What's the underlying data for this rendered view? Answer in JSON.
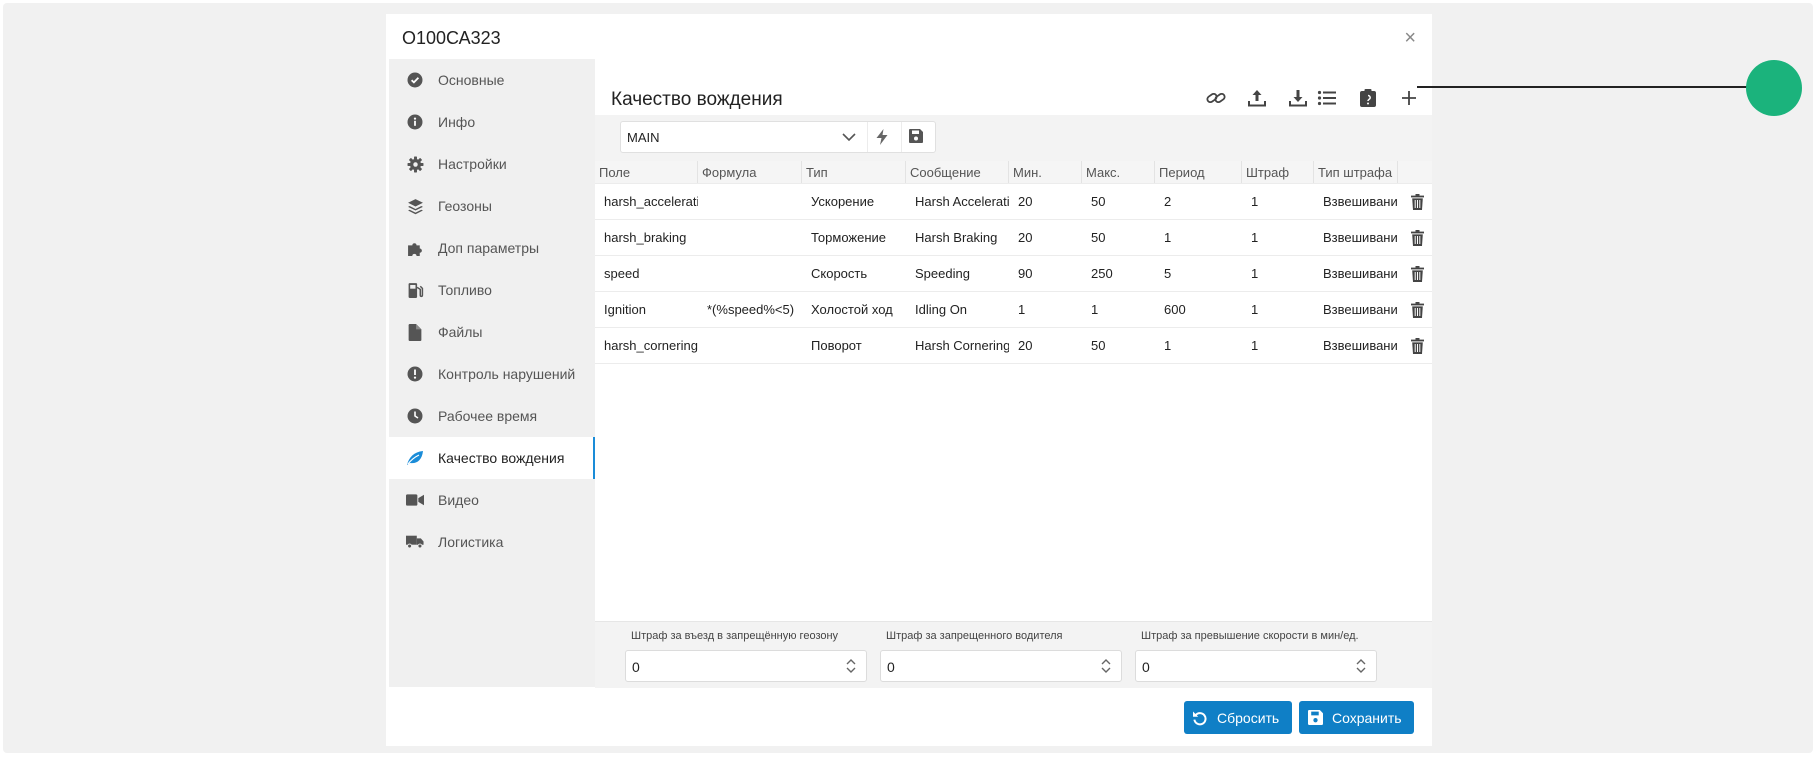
{
  "dialog": {
    "title": "О100СА323",
    "close_glyph": "×"
  },
  "sidebar": {
    "items": [
      {
        "label": "Основные",
        "icon": "check-circle-icon",
        "active": false
      },
      {
        "label": "Инфо",
        "icon": "info-circle-icon",
        "active": false
      },
      {
        "label": "Настройки",
        "icon": "gear-icon",
        "active": false
      },
      {
        "label": "Геозоны",
        "icon": "layers-icon",
        "active": false
      },
      {
        "label": "Доп параметры",
        "icon": "puzzle-icon",
        "active": false
      },
      {
        "label": "Топливо",
        "icon": "fuel-pump-icon",
        "active": false
      },
      {
        "label": "Файлы",
        "icon": "file-icon",
        "active": false
      },
      {
        "label": "Контроль нарушений",
        "icon": "exclamation-circle-icon",
        "active": false
      },
      {
        "label": "Рабочее время",
        "icon": "clock-icon",
        "active": false
      },
      {
        "label": "Качество вождения",
        "icon": "leaf-icon",
        "active": true
      },
      {
        "label": "Видео",
        "icon": "video-camera-icon",
        "active": false
      },
      {
        "label": "Логистика",
        "icon": "truck-icon",
        "active": false
      }
    ]
  },
  "main": {
    "title": "Качество вождения",
    "toolbar": [
      "link-icon",
      "upload-icon",
      "download-icon",
      "list-icon",
      "clipboard-icon",
      "plus-icon"
    ],
    "selector": {
      "value": "MAIN"
    }
  },
  "table": {
    "headers": [
      "Поле",
      "Формула",
      "Тип",
      "Сообщение",
      "Мин.",
      "Макс.",
      "Период",
      "Штраф",
      "Тип штрафа"
    ],
    "rows": [
      [
        "harsh_acceleration",
        "",
        "Ускорение",
        "Harsh Acceleration",
        "20",
        "50",
        "2",
        "1",
        "Взвешивание"
      ],
      [
        "harsh_braking",
        "",
        "Торможение",
        "Harsh Braking",
        "20",
        "50",
        "1",
        "1",
        "Взвешивание"
      ],
      [
        "speed",
        "",
        "Скорость",
        "Speeding",
        "90",
        "250",
        "5",
        "1",
        "Взвешивание"
      ],
      [
        "Ignition",
        "*(%speed%<5)",
        "Холостой ход",
        "Idling On",
        "1",
        "1",
        "600",
        "1",
        "Взвешивание"
      ],
      [
        "harsh_cornering",
        "",
        "Поворот",
        "Harsh Cornering",
        "20",
        "50",
        "1",
        "1",
        "Взвешивание"
      ]
    ]
  },
  "penalties": [
    {
      "label": "Штраф за въезд в запрещённую геозону",
      "value": "0"
    },
    {
      "label": "Штраф за запрещенного водителя",
      "value": "0"
    },
    {
      "label": "Штраф за превышение скорости в мин/ед.",
      "value": "0"
    }
  ],
  "buttons": {
    "reset": "Сбросить",
    "save": "Сохранить"
  },
  "colors": {
    "accent": "#0f7fc6",
    "active_indicator": "#1a8cd8",
    "leaf": "#1a8cd8",
    "marker": "#1bb37c"
  }
}
